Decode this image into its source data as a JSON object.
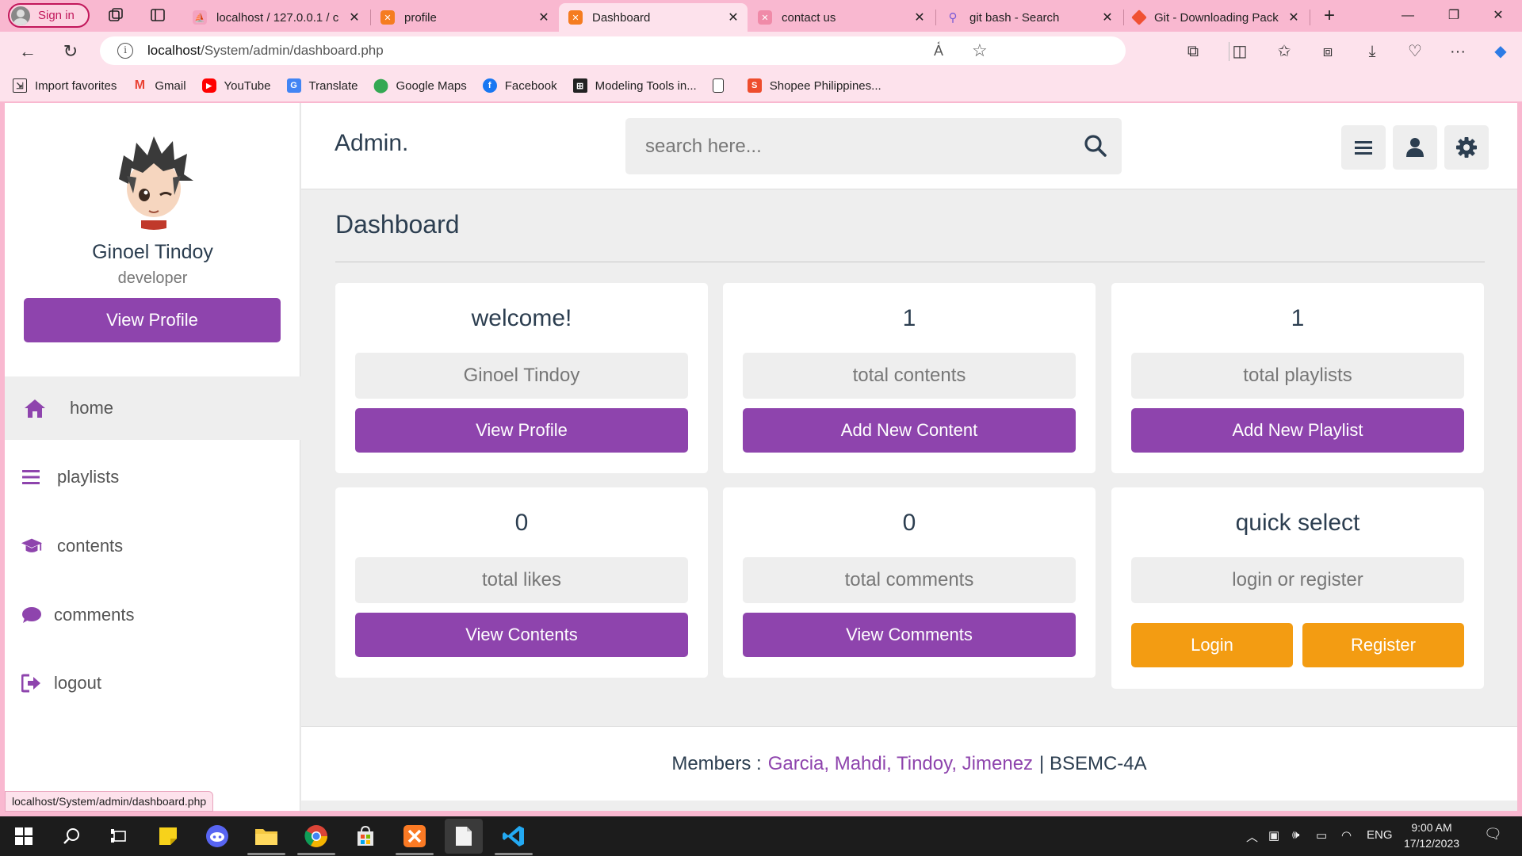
{
  "browser": {
    "signin_label": "Sign in",
    "tabs": [
      {
        "label": "localhost / 127.0.0.1 / c",
        "favicon": "phpmyadmin-icon",
        "active": false
      },
      {
        "label": "profile",
        "favicon": "xampp-icon",
        "active": false
      },
      {
        "label": "Dashboard",
        "favicon": "xampp-icon",
        "active": true
      },
      {
        "label": "contact us",
        "favicon": "xampp-icon",
        "active": false
      },
      {
        "label": "git bash - Search",
        "favicon": "search-icon",
        "active": false
      },
      {
        "label": "Git - Downloading Pack",
        "favicon": "git-icon",
        "active": false
      }
    ],
    "url_host": "localhost",
    "url_path": "/System/admin/dashboard.php",
    "bookmarks": [
      "Import favorites",
      "Gmail",
      "YouTube",
      "Translate",
      "Google Maps",
      "Facebook",
      "Modeling Tools in...",
      "",
      "Shopee Philippines..."
    ]
  },
  "sidebar": {
    "user_name": "Ginoel Tindoy",
    "user_role": "developer",
    "view_profile_label": "View Profile",
    "nav": [
      {
        "label": "home",
        "icon": "home-icon",
        "active": true
      },
      {
        "label": "playlists",
        "icon": "list-icon",
        "active": false
      },
      {
        "label": "contents",
        "icon": "graduation-cap-icon",
        "active": false
      },
      {
        "label": "comments",
        "icon": "comment-icon",
        "active": false
      },
      {
        "label": "logout",
        "icon": "logout-icon",
        "active": false
      }
    ]
  },
  "header": {
    "logo": "Admin.",
    "search_placeholder": "search here..."
  },
  "dashboard": {
    "title": "Dashboard",
    "cards": [
      {
        "big": "welcome!",
        "sub": "Ginoel Tindoy",
        "button": "View Profile"
      },
      {
        "big": "1",
        "sub": "total contents",
        "button": "Add New Content"
      },
      {
        "big": "1",
        "sub": "total playlists",
        "button": "Add New Playlist"
      },
      {
        "big": "0",
        "sub": "total likes",
        "button": "View Contents"
      },
      {
        "big": "0",
        "sub": "total comments",
        "button": "View Comments"
      },
      {
        "big": "quick select",
        "sub": "login or register",
        "button_login": "Login",
        "button_register": "Register"
      }
    ]
  },
  "footer": {
    "prefix": "Members :",
    "members": "Garcia, Mahdi, Tindoy, Jimenez",
    "suffix": "| BSEMC-4A"
  },
  "status_url": "localhost/System/admin/dashboard.php",
  "taskbar": {
    "language": "ENG",
    "time": "9:00 AM",
    "date": "17/12/2023"
  },
  "colors": {
    "accent": "#8e44ad",
    "orange": "#f39c12",
    "browser_pink": "#f9b8d0"
  }
}
